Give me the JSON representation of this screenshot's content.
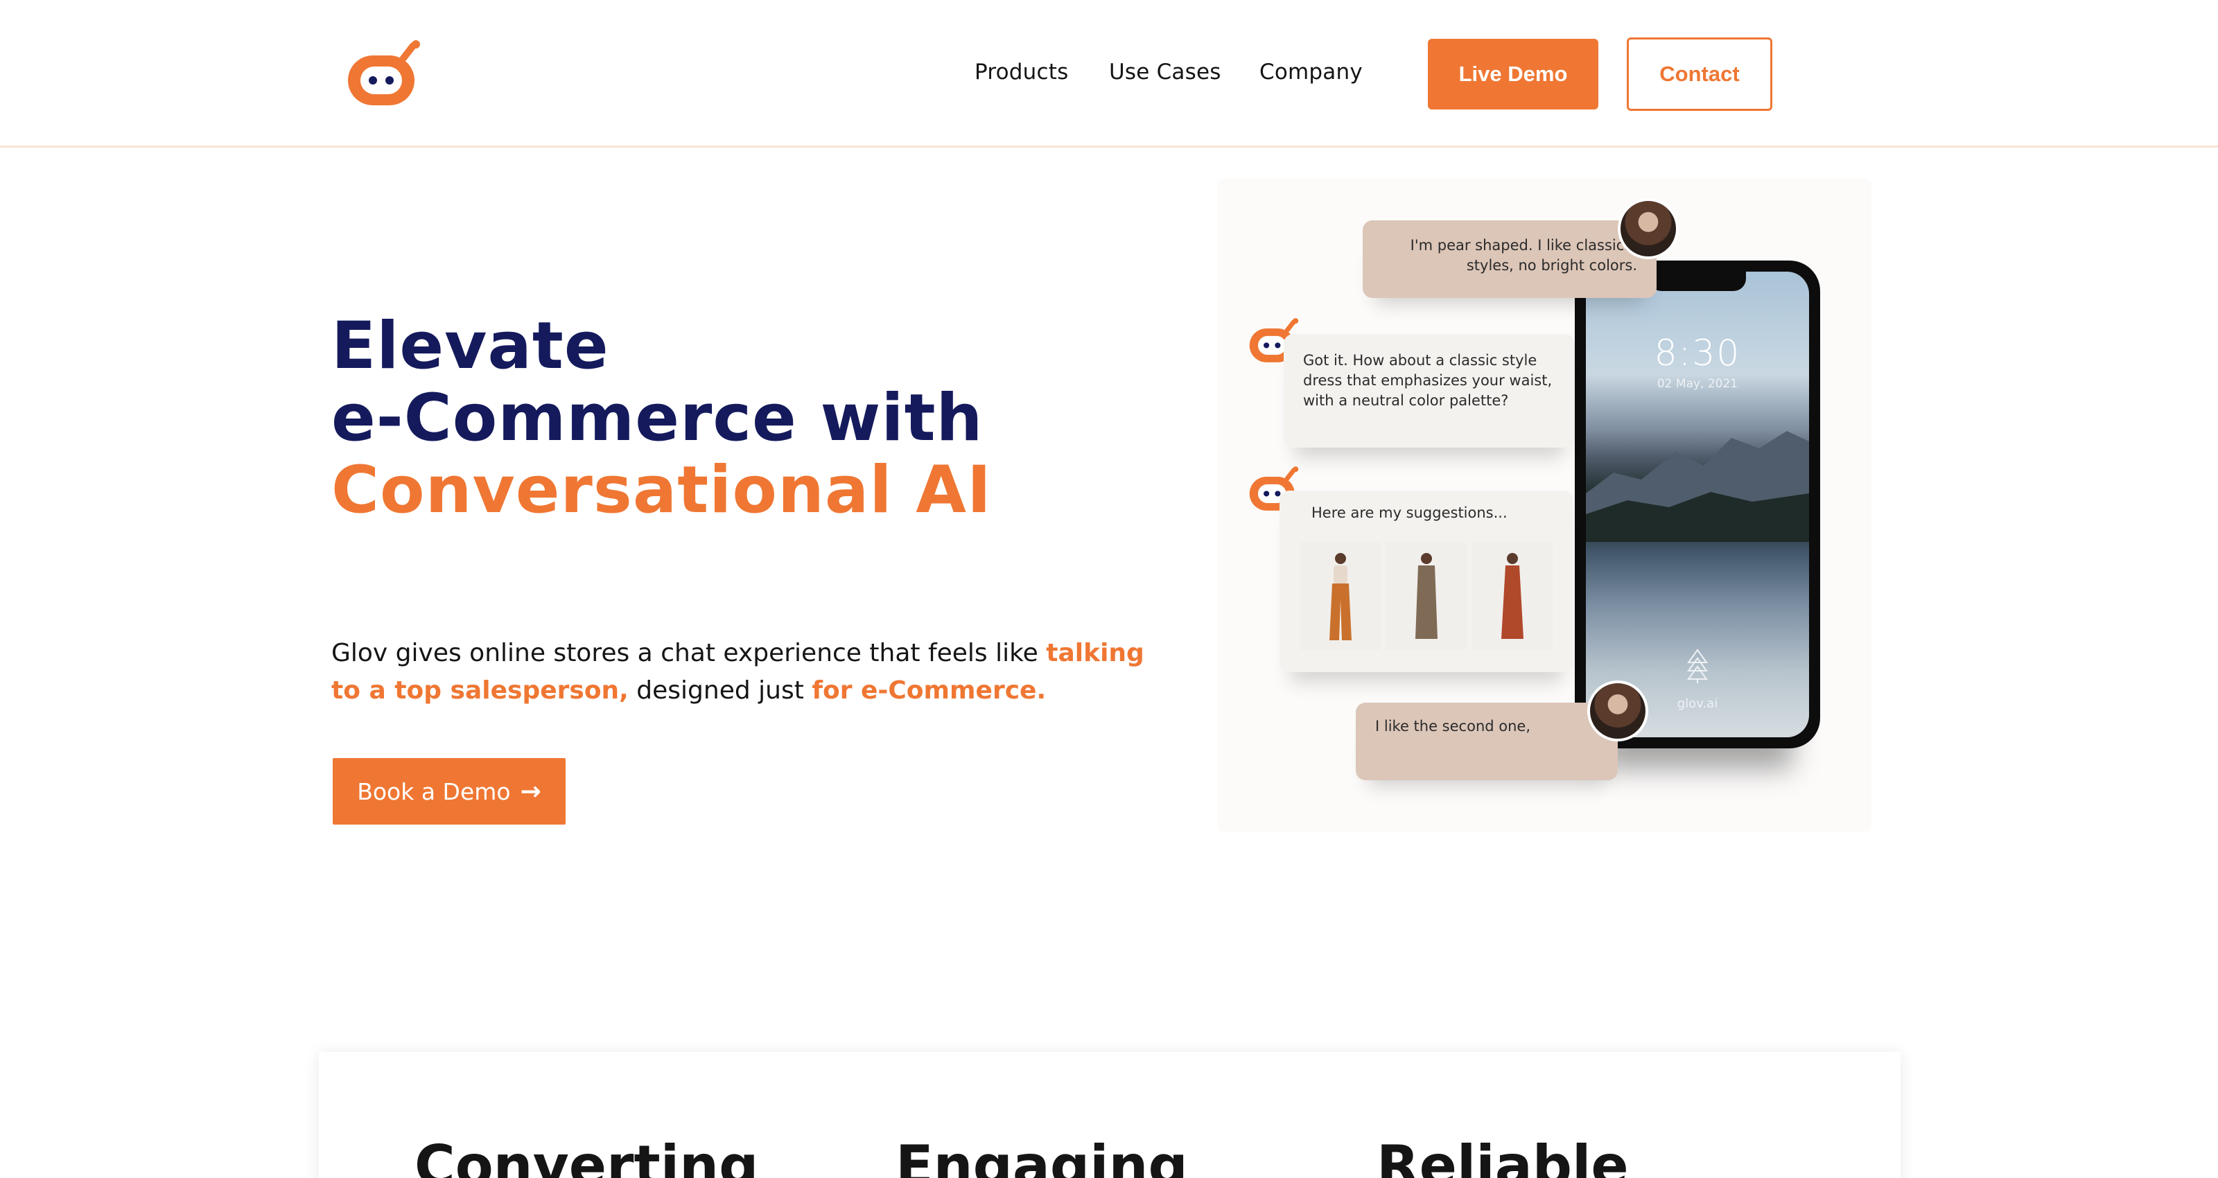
{
  "header": {
    "logo_icon": "robot-face-icon",
    "nav": {
      "products": "Products",
      "use_cases": "Use Cases",
      "company": "Company"
    },
    "live_demo_label": "Live Demo",
    "contact_label": "Contact"
  },
  "hero": {
    "title_line1": "Elevate",
    "title_line2": "e-Commerce with",
    "title_line3": "Conversational AI",
    "desc_part1": "Glov gives online stores a chat experience that feels like ",
    "desc_hl1": "talking to a top salesperson,",
    "desc_part2": " designed just ",
    "desc_hl2": "for e-Commerce.",
    "cta_label": "Book a Demo",
    "cta_icon": "arrow-right-icon"
  },
  "illustration": {
    "user_msg_1": "I'm pear shaped. I like classical styles, no bright colors.",
    "bot_msg_1": "Got it. How about a classic style dress that emphasizes your waist, with a neutral color palette?",
    "bot_msg_2": "Here are my suggestions...",
    "user_msg_2": "I like the second one,",
    "phone_time": "8:30",
    "phone_date": "02 May, 2021",
    "phone_brand": "glov.ai"
  },
  "features": {
    "item1": "Converting",
    "item2": "Engaging",
    "item3": "Reliable"
  },
  "colors": {
    "accent": "#ef7733",
    "navy": "#141a5c",
    "bubble_user": "#dcc6b8",
    "bubble_bot": "#f4f2ef"
  }
}
